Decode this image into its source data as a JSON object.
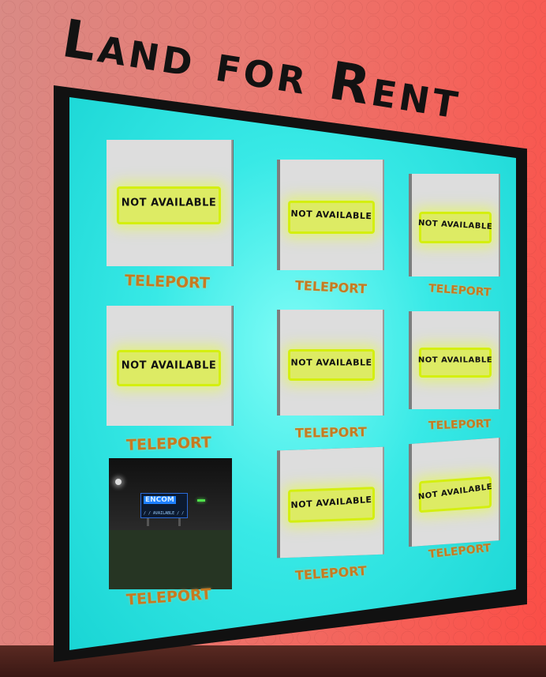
{
  "sign": {
    "title": "Land for Rent"
  },
  "parcels": [
    {
      "status": "NOT AVAILABLE",
      "action": "TELEPORT"
    },
    {
      "status": "NOT AVAILABLE",
      "action": "TELEPORT"
    },
    {
      "status": "NOT AVAILABLE",
      "action": "TELEPORT"
    },
    {
      "status": "NOT AVAILABLE",
      "action": "TELEPORT"
    },
    {
      "status": "NOT AVAILABLE",
      "action": "TELEPORT"
    },
    {
      "status": "NOT AVAILABLE",
      "action": "TELEPORT"
    },
    {
      "status": "",
      "action": "TELEPORT",
      "preview": {
        "logo": "ENCOM",
        "caption": "/ / AVAILABLE / /"
      }
    },
    {
      "status": "NOT AVAILABLE",
      "action": "TELEPORT"
    },
    {
      "status": "NOT AVAILABLE",
      "action": "TELEPORT"
    }
  ],
  "colors": {
    "wall": "#f56058",
    "screen_glow": "#38e9e6",
    "badge": "#d2f000",
    "teleport_text": "#c77a20",
    "frame": "#111111"
  }
}
